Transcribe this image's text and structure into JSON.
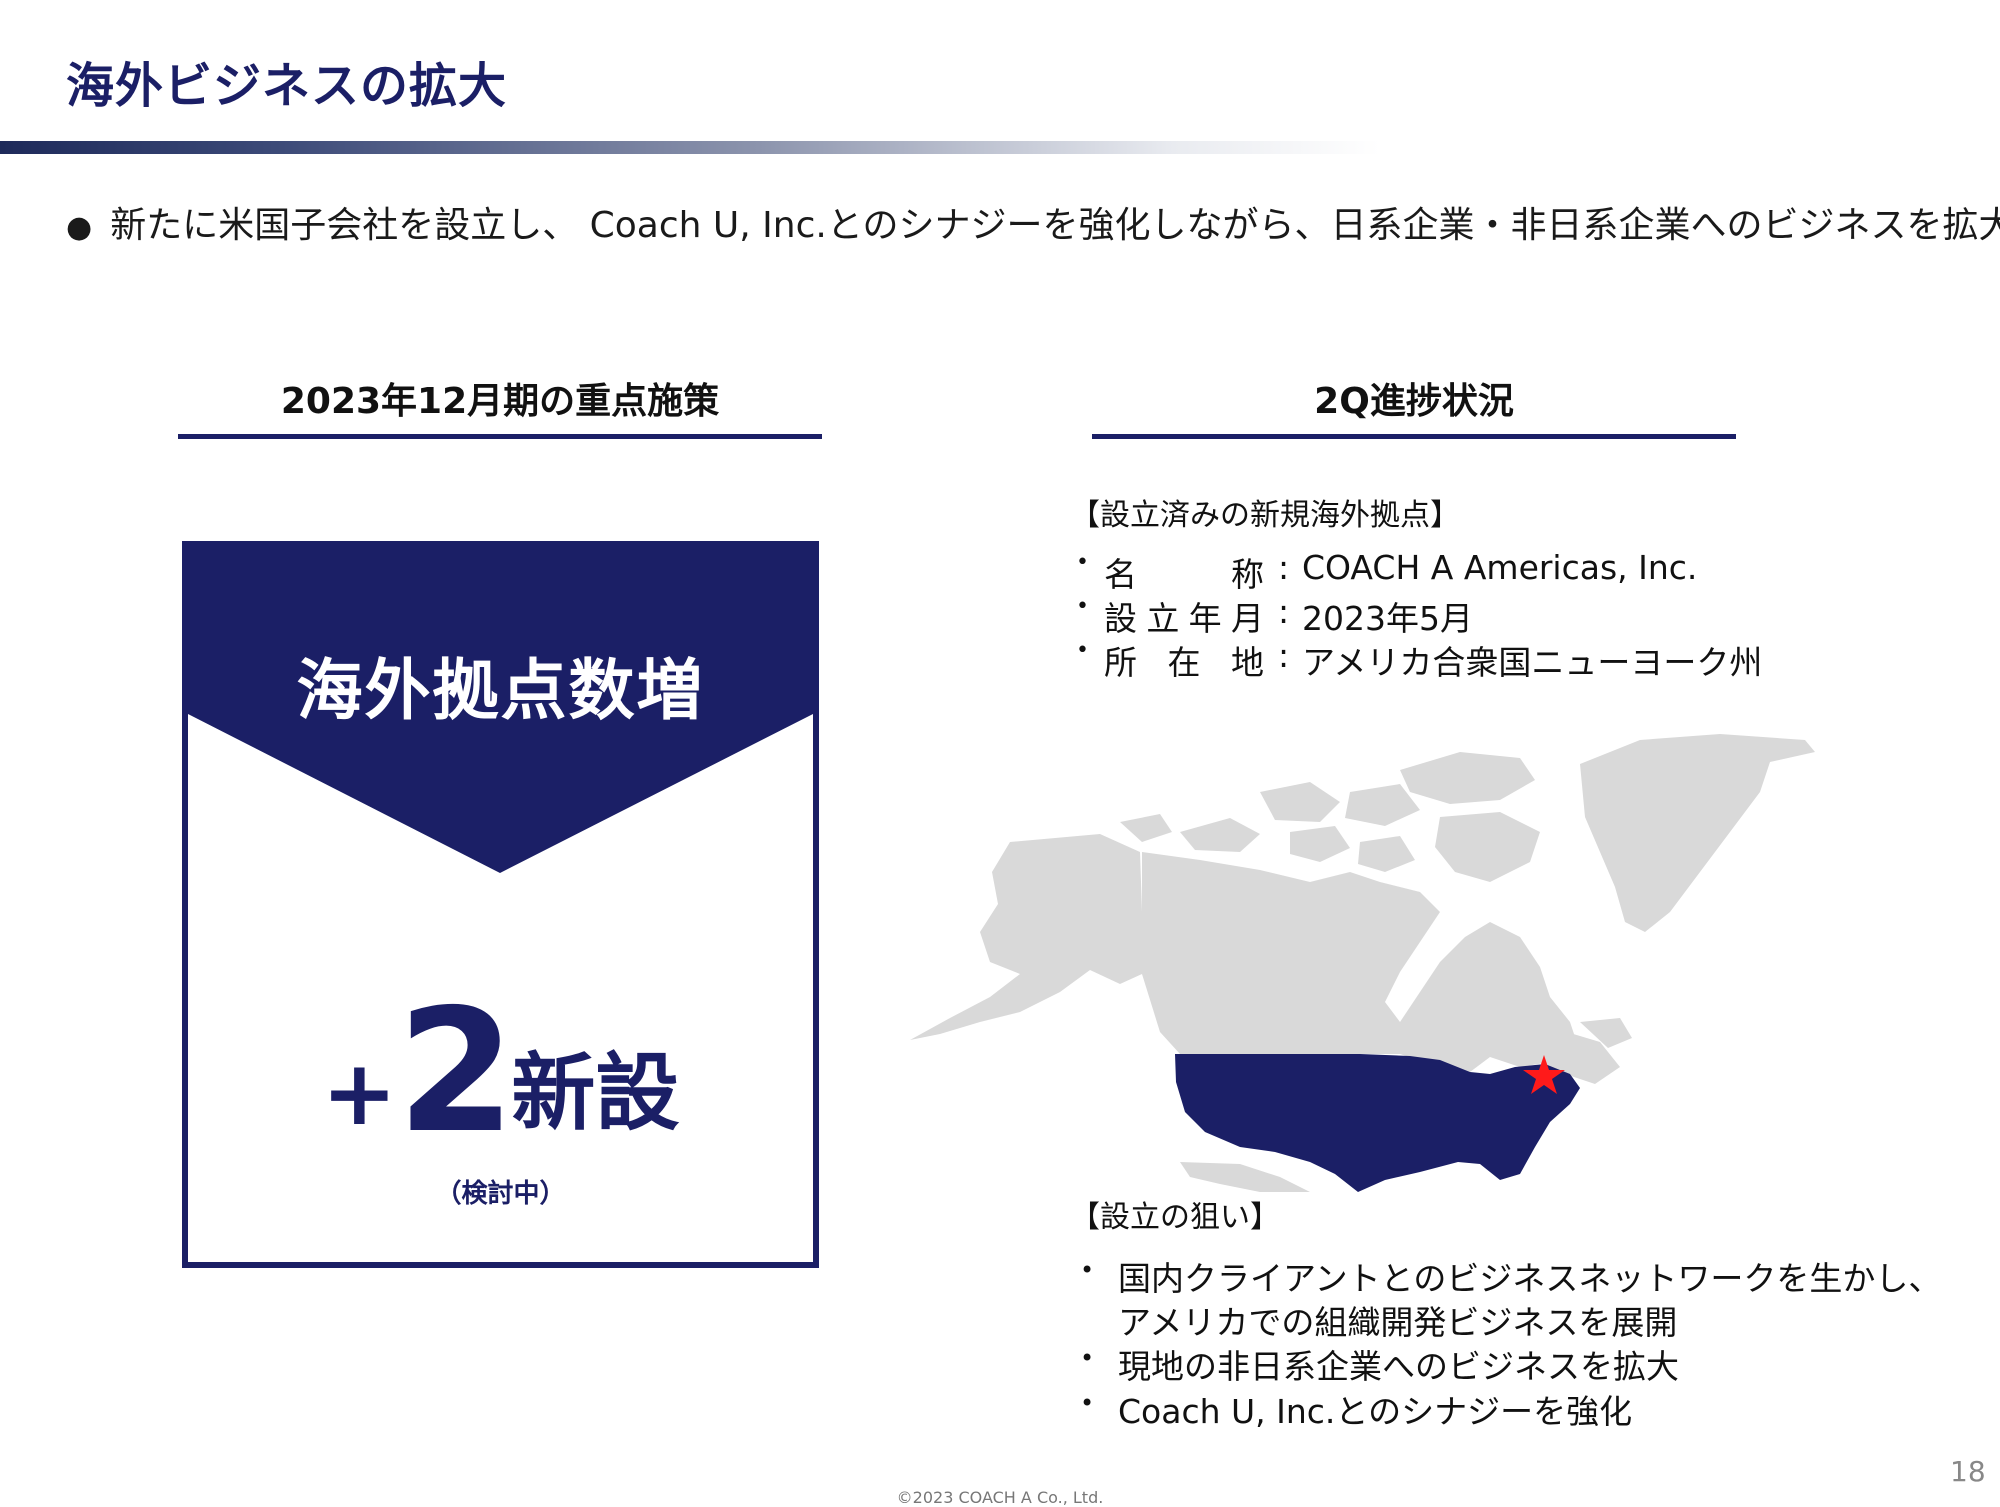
{
  "slide": {
    "title": "海外ビジネスの拡大",
    "lead_bullet": "●",
    "lead": "新たに米国子会社を設立し、 Coach U, Inc.とのシナジーを強化しながら、日系企業・非日系企業へのビジネスを拡大",
    "page_number": "18",
    "copyright": "©2023  COACH A Co., Ltd."
  },
  "left_column": {
    "heading": "2023年12月期の重点施策",
    "card": {
      "title": "海外拠点数増",
      "plus": "+",
      "number": "2",
      "unit": "新設",
      "note": "（検討中）"
    }
  },
  "right_column": {
    "heading": "2Q進捗状況",
    "established": {
      "heading": "【設立済みの新規海外拠点】",
      "rows": [
        {
          "bullet": "•",
          "label": "名称",
          "colon": ":",
          "value": "COACH A Americas, Inc."
        },
        {
          "bullet": "•",
          "label": "設立年月",
          "colon": ":",
          "value": "2023年5月"
        },
        {
          "bullet": "•",
          "label": "所在地",
          "colon": ":",
          "value": "アメリカ合衆国ニューヨーク州"
        }
      ]
    },
    "aims": {
      "heading": "【設立の狙い】",
      "items": [
        {
          "bullet": "•",
          "line1": "国内クライアントとのビジネスネットワークを生かし、",
          "line2": "アメリカでの組織開発ビジネスを展開"
        },
        {
          "bullet": "•",
          "line1": "現地の非日系企業へのビジネスを拡大"
        },
        {
          "bullet": "•",
          "line1": "Coach U, Inc.とのシナジーを強化"
        }
      ]
    }
  },
  "colors": {
    "navy": "#1b1f66",
    "map_land": "#d9d9d9",
    "marker": "#ff1a1a"
  }
}
